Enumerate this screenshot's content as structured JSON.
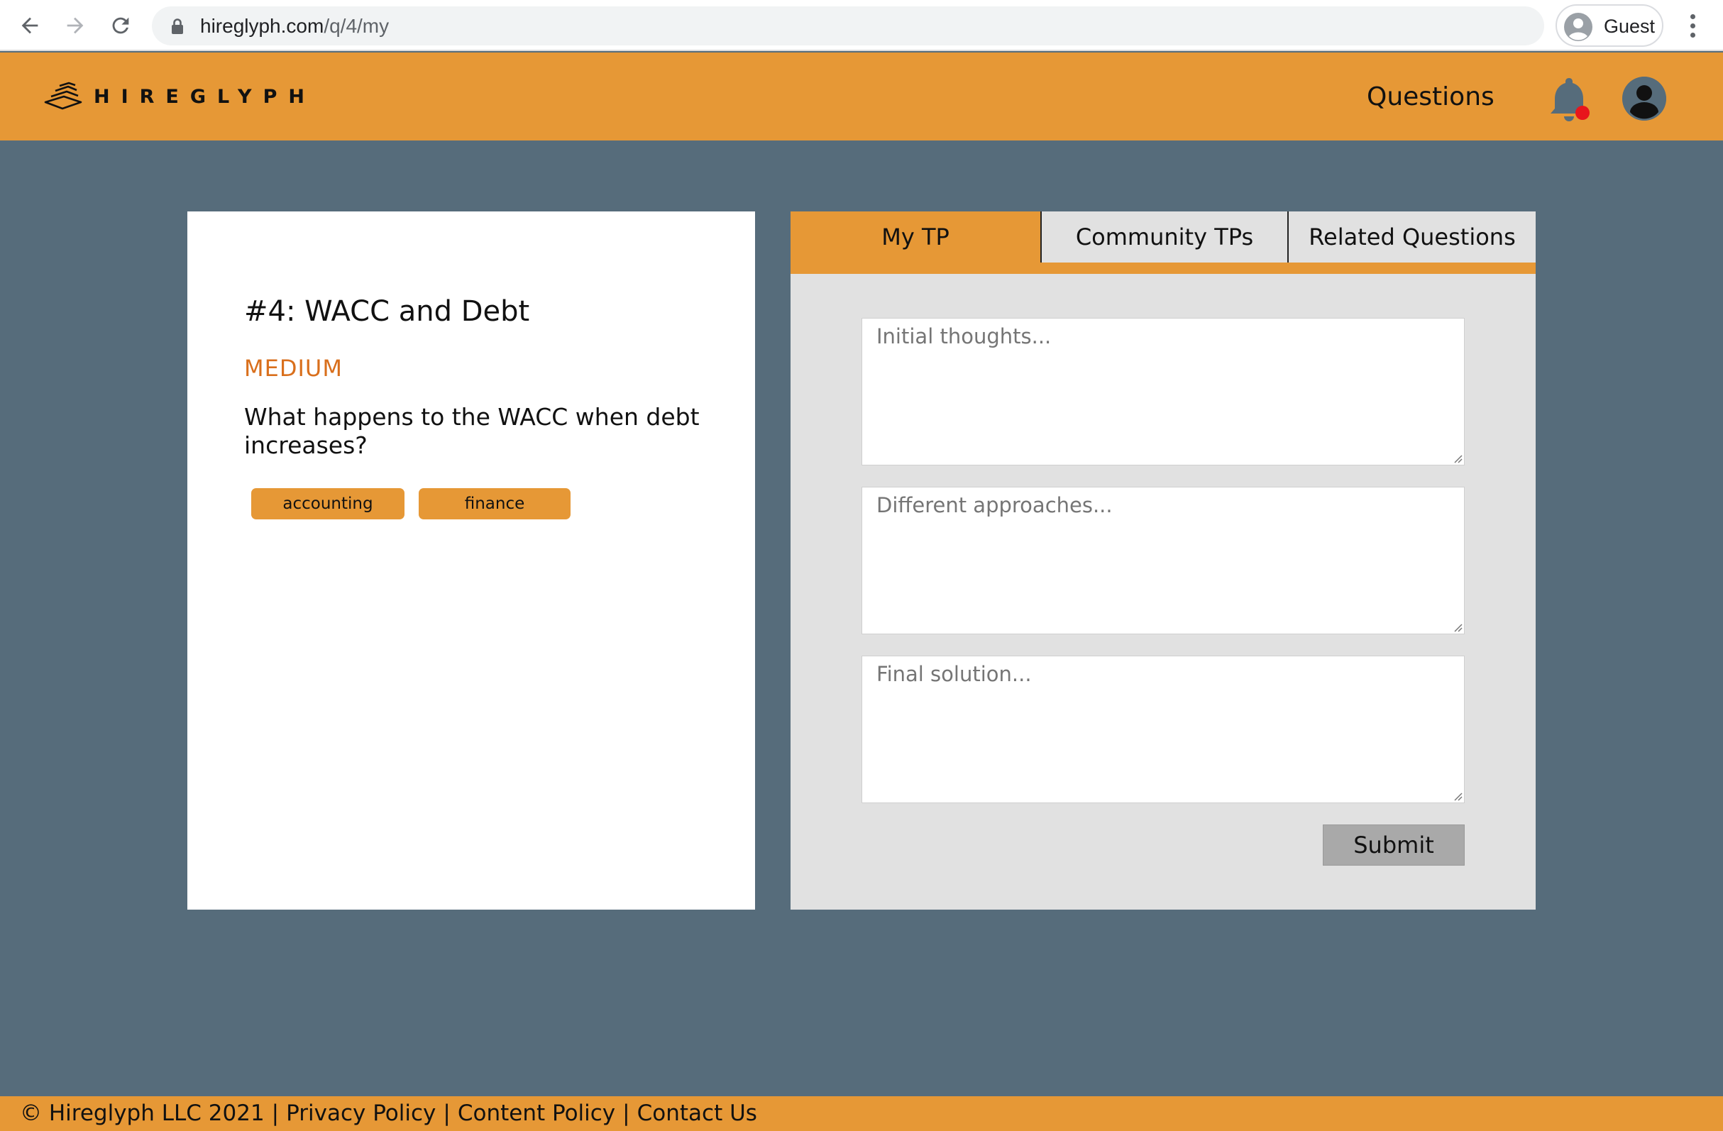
{
  "browser": {
    "url_host": "hireglyph.com",
    "url_path": "/q/4/my",
    "profile_label": "Guest",
    "icons": [
      "back-arrow-icon",
      "forward-arrow-icon",
      "reload-icon",
      "lock-icon",
      "profile-icon",
      "more-vert-icon"
    ]
  },
  "header": {
    "logo_text": "HIREGLYPH",
    "nav_questions": "Questions",
    "colors": {
      "brand": "#e69836",
      "notification_dot": "#e8161c"
    }
  },
  "question": {
    "title": "#4: WACC and Debt",
    "difficulty": "MEDIUM",
    "difficulty_color": "#d96f1c",
    "text": "What happens to the WACC when debt increases?",
    "tags": [
      "accounting",
      "finance"
    ]
  },
  "panel": {
    "tabs": [
      {
        "label": "My TP",
        "active": true
      },
      {
        "label": "Community TPs",
        "active": false
      },
      {
        "label": "Related Questions",
        "active": false
      }
    ],
    "fields": [
      {
        "placeholder": "Initial thoughts...",
        "value": ""
      },
      {
        "placeholder": "Different approaches...",
        "value": ""
      },
      {
        "placeholder": "Final solution...",
        "value": ""
      }
    ],
    "submit_label": "Submit"
  },
  "footer": {
    "copyright": "© Hireglyph LLC 2021",
    "links": [
      "Privacy Policy",
      "Content Policy",
      "Contact Us"
    ],
    "separator": "|"
  },
  "colors": {
    "background": "#566c7b",
    "panel_bg": "#e1e1e1",
    "submit_bg": "#a9a9a9"
  }
}
